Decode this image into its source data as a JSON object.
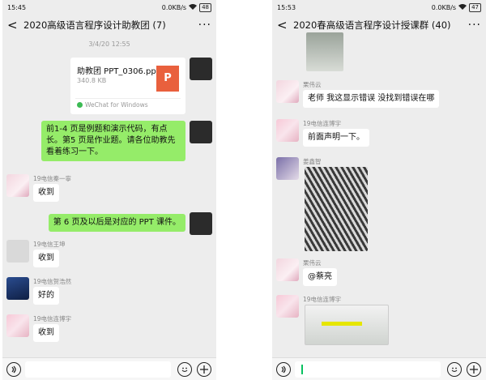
{
  "left": {
    "status": {
      "time": "15:45",
      "speed": "0.0KB/s",
      "battery": "48"
    },
    "header": {
      "title": "2020高级语言程序设计助教团 (7)",
      "more": "···",
      "back": "<"
    },
    "timestamp": "3/4/20 12:55",
    "file": {
      "name": "助教团 PPT_0306.pptx",
      "size": "340.8 KB",
      "icon_letter": "P",
      "source": "WeChat for Windows"
    },
    "messages": [
      {
        "type": "sent",
        "text": "前1-4 页是例题和演示代码，有点长。第5 页是作业题。请各位助教先看着练习一下。"
      },
      {
        "type": "received",
        "sender": "19电信秦一寧",
        "text": "收到"
      },
      {
        "type": "sent",
        "text": "第 6 页及以后是对应的 PPT 课件。"
      },
      {
        "type": "received",
        "sender": "19电信王坤",
        "text": "收到"
      },
      {
        "type": "received",
        "sender": "19电信贺浩然",
        "text": "好的"
      },
      {
        "type": "received",
        "sender": "19电信连博宇",
        "text": "收到"
      }
    ]
  },
  "right": {
    "status": {
      "time": "15:53",
      "speed": "0.0KB/s",
      "battery": "47"
    },
    "header": {
      "title": "2020春高级语言程序设计授课群 (40)",
      "more": "···",
      "back": "<"
    },
    "messages": [
      {
        "type": "image",
        "sender": ""
      },
      {
        "type": "received",
        "sender": "栗伟云",
        "text": "老师 我这显示错误 没找到错误在哪"
      },
      {
        "type": "received",
        "sender": "19电信连博宇",
        "text": "前面声明一下。"
      },
      {
        "type": "image",
        "sender": "姜鑫智"
      },
      {
        "type": "received",
        "sender": "栗伟云",
        "text": "@蔡亮"
      },
      {
        "type": "image",
        "sender": "19电信连博宇"
      }
    ]
  },
  "input": {
    "voice_icon": "voice-icon",
    "emoji_icon": "emoji-icon",
    "plus_icon": "plus-icon"
  }
}
